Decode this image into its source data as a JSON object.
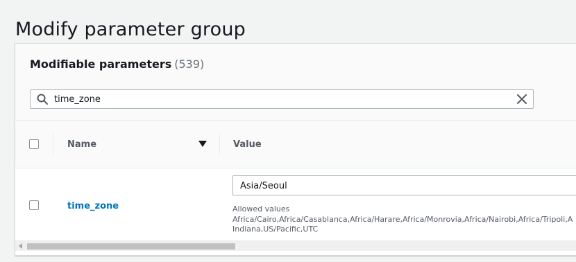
{
  "page": {
    "title": "Modify parameter group"
  },
  "panel": {
    "title": "Modifiable parameters",
    "count": "(539)"
  },
  "search": {
    "value": "time_zone",
    "icon": "search-icon",
    "clear_icon": "close-icon"
  },
  "table": {
    "columns": {
      "name": "Name",
      "value": "Value"
    },
    "rows": [
      {
        "name": "time_zone",
        "value": "Asia/Seoul",
        "allowed_label": "Allowed values",
        "allowed_line1": "Africa/Cairo,Africa/Casablanca,Africa/Harare,Africa/Monrovia,Africa/Nairobi,Africa/Tripoli,A",
        "allowed_line2": "Indiana,US/Pacific,UTC"
      }
    ]
  },
  "colors": {
    "link": "#0073bb",
    "page_bg": "#f2f3f3",
    "border": "#aab7b8"
  }
}
